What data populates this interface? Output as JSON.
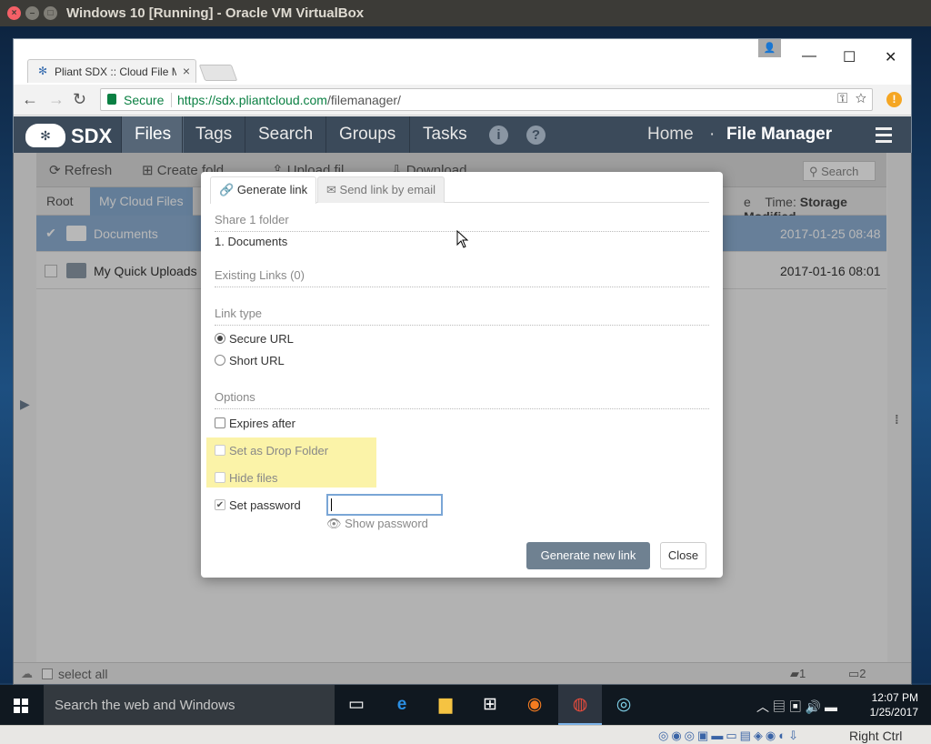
{
  "host": {
    "title": "Windows 10 [Running] - Oracle VM VirtualBox",
    "right_ctrl": "Right Ctrl"
  },
  "browser": {
    "tab_title": "Pliant SDX :: Cloud File M",
    "secure_label": "Secure",
    "url_scheme_host": "https://sdx.pliantcloud.com",
    "url_path": "/filemanager/"
  },
  "app": {
    "logo": "SDX",
    "nav": [
      "Files",
      "Tags",
      "Search",
      "Groups",
      "Tasks"
    ],
    "home": "Home",
    "separator": "·",
    "section": "File Manager",
    "actions": {
      "refresh": "Refresh",
      "create": "Create fold",
      "upload": "Upload fil",
      "download": "Download",
      "search_placeholder": "Search"
    },
    "breadcrumb": [
      "Root",
      "My Cloud Files"
    ],
    "time_label": "Time:",
    "time_value": "Storage Modified",
    "time_prefix_clipped": "e",
    "rows": [
      {
        "name": "Documents",
        "date": "2017-01-25 08:48",
        "selected": true
      },
      {
        "name": "My Quick Uploads",
        "date": "2017-01-16 08:01",
        "selected": false
      }
    ],
    "status": {
      "select_all": "select all",
      "files_count": "1",
      "folders_count": "2"
    }
  },
  "modal": {
    "tab_generate": "Generate link",
    "tab_email": "Send link by email",
    "share_heading": "Share 1 folder",
    "share_item": "1. Documents",
    "existing_links": "Existing Links (0)",
    "link_type_heading": "Link type",
    "link_types": [
      "Secure URL",
      "Short URL"
    ],
    "selected_link_type": "Secure URL",
    "options_heading": "Options",
    "options": {
      "expires_after": "Expires after",
      "drop_folder": "Set as Drop Folder",
      "hide_files": "Hide files",
      "set_password": "Set password"
    },
    "password_value": "",
    "show_password": "Show password",
    "generate_button": "Generate new link",
    "close_button": "Close"
  },
  "taskbar": {
    "search_placeholder": "Search the web and Windows",
    "time": "12:07 PM",
    "date": "1/25/2017"
  },
  "colors": {
    "nav_bg": "#3b4a5a",
    "selected_row": "#8fb0d4",
    "primary_button": "#6f8191",
    "highlight": "#fbf3a8"
  }
}
